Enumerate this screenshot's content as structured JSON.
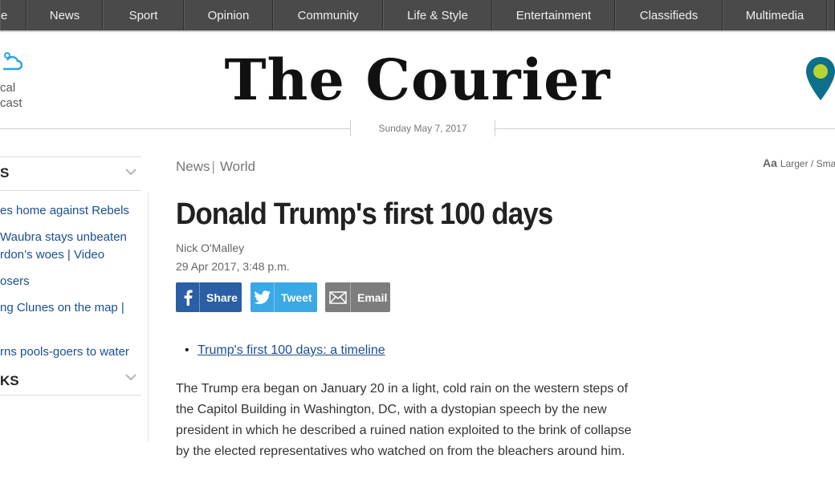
{
  "nav": {
    "items": [
      "e",
      "News",
      "Sport",
      "Opinion",
      "Community",
      "Life & Style",
      "Entertainment",
      "Classifieds",
      "Multimedia"
    ]
  },
  "weather": {
    "line1": "cal",
    "line2": "cast"
  },
  "masthead": {
    "logo": "The Courier",
    "date": "Sunday May 7, 2017"
  },
  "sidebar": {
    "section1_title": "S",
    "links": [
      "es home against Rebels",
      "Waubra stays unbeaten",
      "rdon’s woes | Video",
      "osers",
      "ng Clunes on the map |",
      "rns pools-goers to water"
    ],
    "section2_title": "KS"
  },
  "article": {
    "breadcrumb": [
      "News",
      "World"
    ],
    "textsize_label": "Larger / Sma",
    "textsize_icon": "Aa",
    "headline": "Donald Trump's first 100 days",
    "author": "Nick O'Malley",
    "date": "29 Apr 2017, 3:48 p.m.",
    "share": {
      "facebook": "Share",
      "twitter": "Tweet",
      "email": "Email"
    },
    "related_link": "Trump's first 100 days: a timeline",
    "body": "The Trump era began on January 20 in a light, cold rain on the western steps of the Capitol Building in Washington, DC, with a dystopian speech by the new president in which he described a ruined nation exploited to the brink of collapse by the elected representatives who watched on from the bleachers around him."
  },
  "colors": {
    "nav_bg": "#4a4a4a",
    "link": "#1a4e91",
    "facebook": "#2a5ea5",
    "twitter": "#3aa9e6",
    "email": "#7d7d7d",
    "pin": "#0d6f8c",
    "pin_dot": "#b7d431"
  }
}
